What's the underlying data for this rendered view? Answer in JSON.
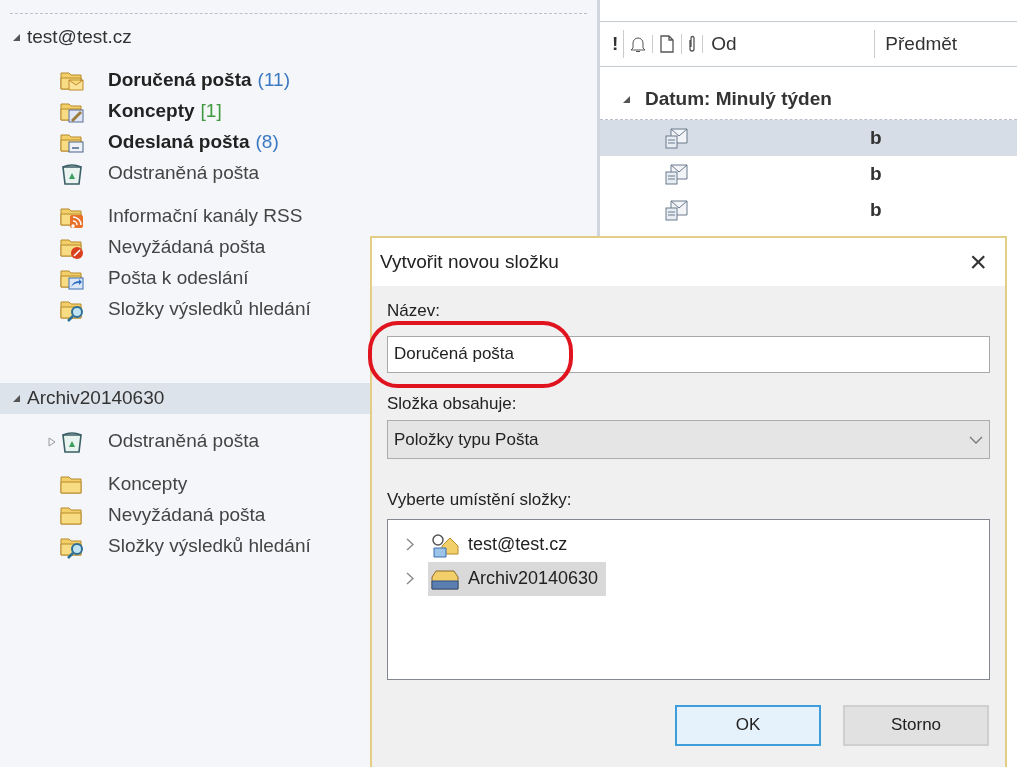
{
  "folder_pane": {
    "accounts": [
      {
        "label": "test@test.cz",
        "expanded": true,
        "selected": false,
        "groups": [
          [
            {
              "label": "Doručená pošta",
              "kind": "inbox",
              "unread": true,
              "count": "(11)",
              "color": "#3a78c2",
              "expandable": false
            },
            {
              "label": "Koncepty",
              "kind": "drafts",
              "unread": true,
              "count": "[1]",
              "color": "#3f9a3f",
              "expandable": false
            },
            {
              "label": "Odeslaná pošta",
              "kind": "sent",
              "unread": true,
              "count": "(8)",
              "color": "#3a78c2",
              "expandable": false
            },
            {
              "label": "Odstraněná pošta",
              "kind": "trash",
              "unread": false,
              "expandable": false
            }
          ],
          [
            {
              "label": "Informační kanály RSS",
              "kind": "rss",
              "unread": false,
              "expandable": false
            },
            {
              "label": "Nevyžádaná pošta",
              "kind": "junk",
              "unread": false,
              "expandable": false
            },
            {
              "label": "Pošta k odeslání",
              "kind": "outbox",
              "unread": false,
              "expandable": false
            },
            {
              "label": "Složky výsledků hledání",
              "kind": "search",
              "unread": false,
              "expandable": false
            }
          ]
        ]
      },
      {
        "label": "Archiv20140630",
        "expanded": true,
        "selected": true,
        "groups": [
          [
            {
              "label": "Odstraněná pošta",
              "kind": "trash",
              "unread": false,
              "expandable": true
            }
          ],
          [
            {
              "label": "Koncepty",
              "kind": "folder",
              "unread": false,
              "expandable": false
            },
            {
              "label": "Nevyžádaná pošta",
              "kind": "folder",
              "unread": false,
              "expandable": false
            },
            {
              "label": "Složky výsledků hledání",
              "kind": "search",
              "unread": false,
              "expandable": false
            }
          ]
        ]
      }
    ]
  },
  "message_list": {
    "columns": {
      "importance": "!",
      "from": "Od",
      "subject": "Předmět"
    },
    "group": {
      "label": "Datum: Minulý týden",
      "expanded": true
    },
    "rows": [
      {
        "subject": "b",
        "selected": true,
        "unread": true
      },
      {
        "subject": "b",
        "selected": false,
        "unread": true
      },
      {
        "subject": "b",
        "selected": false,
        "unread": true
      }
    ]
  },
  "dialog": {
    "title": "Vytvořit novou složku",
    "close": "×",
    "name_label": "Název:",
    "name_value": "Doručená pošta",
    "contains_label": "Složka obsahuje:",
    "contains_value": "Položky typu Pošta",
    "location_label": "Vyberte umístění složky:",
    "tree": [
      {
        "label": "test@test.cz",
        "kind": "account",
        "selected": false
      },
      {
        "label": "Archiv20140630",
        "kind": "archive",
        "selected": true
      }
    ],
    "buttons": [
      {
        "label": "OK",
        "default": true
      },
      {
        "label": "Storno",
        "default": false
      }
    ]
  }
}
